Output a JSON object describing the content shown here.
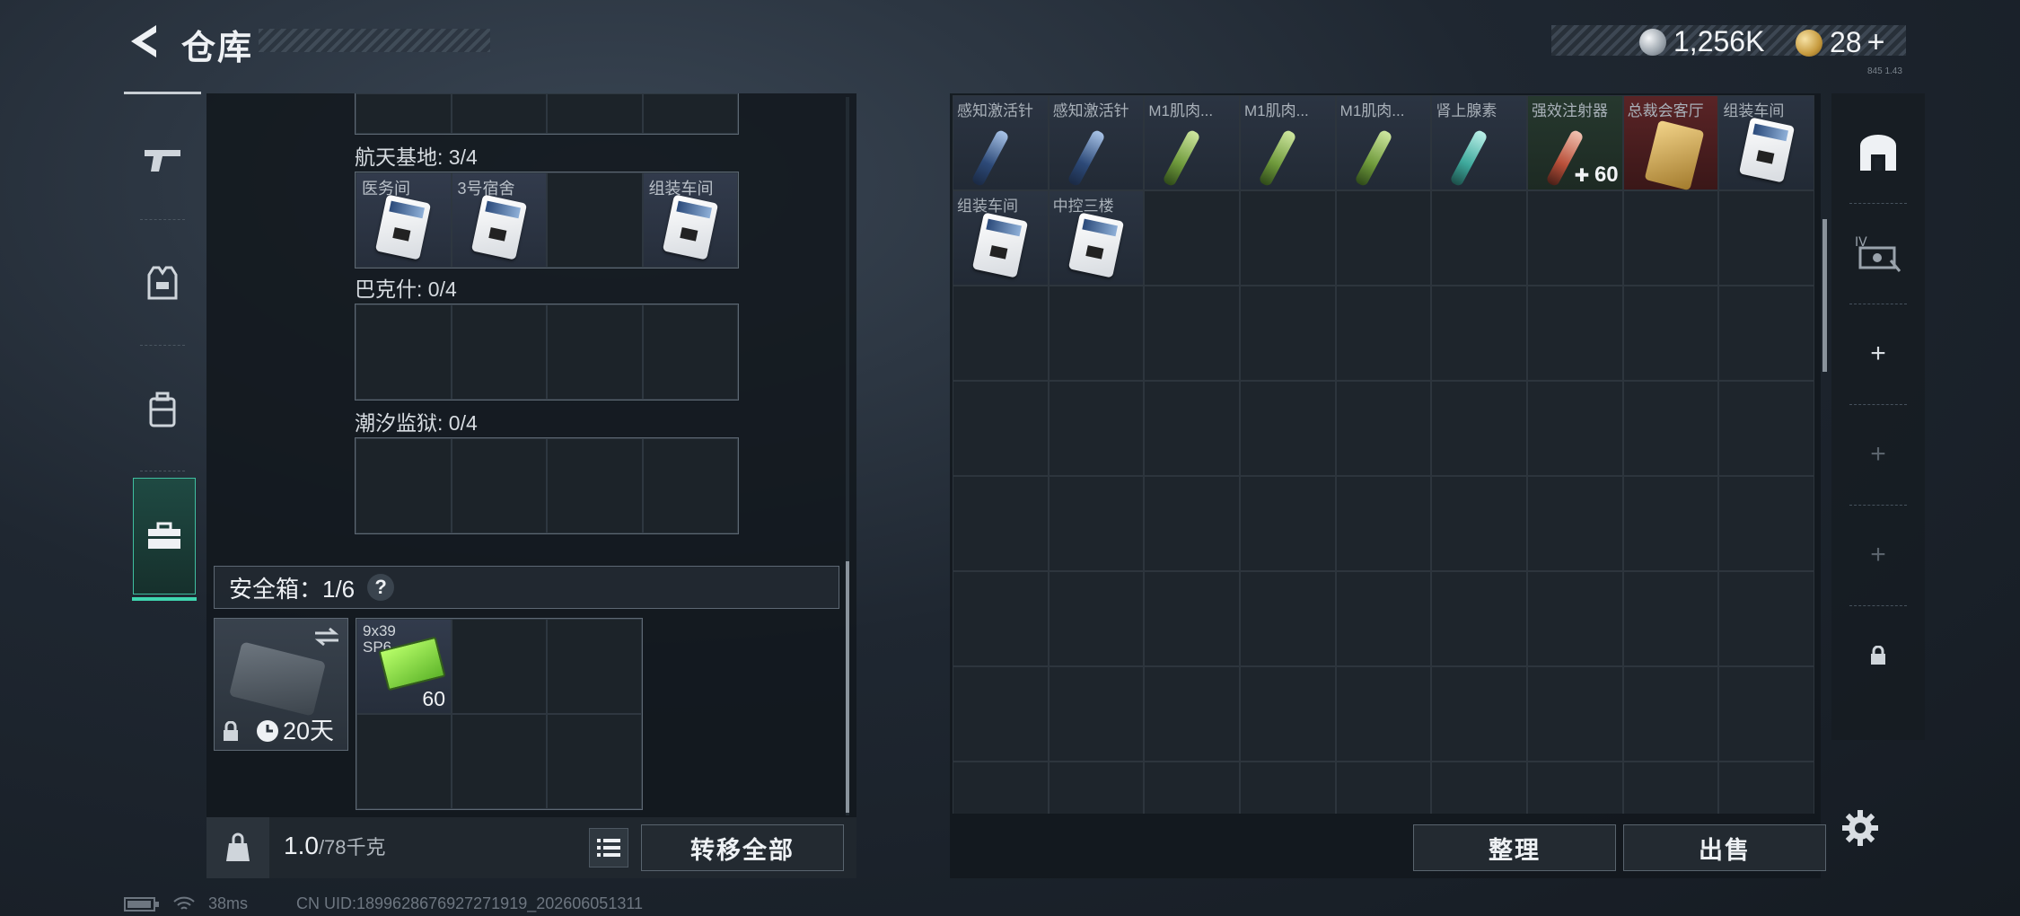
{
  "header": {
    "title": "仓库",
    "currency_1": "1,256K",
    "currency_2": "28",
    "currency_2_plus": "+",
    "version_tag": "845 1.43"
  },
  "left_tabs": [
    {
      "name": "weapons",
      "icon": "pistol-icon"
    },
    {
      "name": "armor",
      "icon": "vest-icon"
    },
    {
      "name": "backpack",
      "icon": "backpack-icon"
    },
    {
      "name": "toolbox",
      "icon": "toolbox-icon",
      "active": true
    }
  ],
  "key_sections": [
    {
      "label": "航天基地: 3/4",
      "cells": [
        "医务间",
        "3号宿舍",
        "",
        "组装车间"
      ]
    },
    {
      "label": "巴克什: 0/4",
      "cells": [
        "",
        "",
        "",
        ""
      ]
    },
    {
      "label": "潮汐监狱: 0/4",
      "cells": [
        "",
        "",
        "",
        ""
      ]
    }
  ],
  "safebox": {
    "label": "安全箱：1/6",
    "help": "?",
    "duration": "20天",
    "ammo_label_line1": "9x39",
    "ammo_label_line2": "SP6",
    "ammo_count": "60"
  },
  "left_bottom": {
    "weight_value": "1.0",
    "weight_max": "/78千克",
    "transfer_all": "转移全部"
  },
  "stash": {
    "row1": [
      {
        "label": "感知激活针",
        "kind": "syr-blue",
        "bg": "item-bg-dark"
      },
      {
        "label": "感知激活针",
        "kind": "syr-blue",
        "bg": "item-bg-dark"
      },
      {
        "label": "M1肌肉...",
        "kind": "syr-green",
        "bg": "item-bg-dark"
      },
      {
        "label": "M1肌肉...",
        "kind": "syr-green",
        "bg": "item-bg-dark"
      },
      {
        "label": "M1肌肉...",
        "kind": "syr-green",
        "bg": "item-bg-dark"
      },
      {
        "label": "肾上腺素",
        "kind": "syr-teal",
        "bg": "item-bg-dark"
      },
      {
        "label": "强效注射器",
        "kind": "syr-red",
        "bg": "item-bg-green",
        "count": "60"
      },
      {
        "label": "总裁会客厅",
        "kind": "gold-card",
        "bg": "item-bg-red"
      },
      {
        "label": "组装车间",
        "kind": "keycard",
        "bg": "item-bg-dark"
      }
    ],
    "row2": [
      {
        "label": "组装车间",
        "kind": "keycard",
        "bg": "item-bg-dark"
      },
      {
        "label": "中控三楼",
        "kind": "keycard",
        "bg": "item-bg-dark"
      }
    ],
    "arrange": "整理",
    "sell": "出售"
  },
  "right_col": {
    "plus_1": "+",
    "plus_2": "+",
    "plus_3": "+"
  },
  "status": {
    "ping": "38ms",
    "uid": "CN UID:1899628676927271919_202606051311"
  }
}
